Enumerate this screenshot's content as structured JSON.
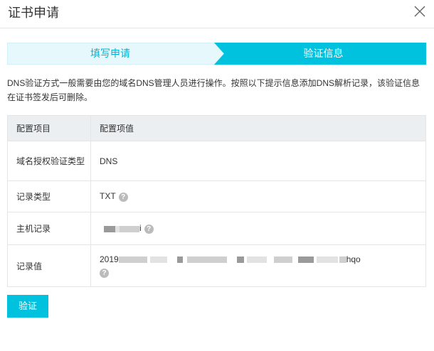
{
  "dialog": {
    "title": "证书申请"
  },
  "steps": [
    {
      "label": "填写申请",
      "active": false
    },
    {
      "label": "验证信息",
      "active": true
    }
  ],
  "description": "DNS验证方式一般需要由您的域名DNS管理人员进行操作。按照以下提示信息添加DNS解析记录，该验证信息在证书签发后可删除。",
  "table": {
    "headers": [
      "配置项目",
      "配置项值"
    ],
    "rows": [
      {
        "item": "域名授权验证类型",
        "value": "DNS"
      },
      {
        "item": "记录类型",
        "value": "TXT"
      },
      {
        "item": "主机记录",
        "value": "i"
      },
      {
        "item": "记录值",
        "value_prefix": "2019",
        "value_suffix": "hqo"
      }
    ]
  },
  "buttons": {
    "verify": "验证"
  },
  "colors": {
    "accent": "#00c1de",
    "step_inactive_bg": "#e6f8fb",
    "table_header_bg": "#eceff2"
  },
  "icons": {
    "close": "close-icon",
    "help": "question-circle-icon"
  }
}
